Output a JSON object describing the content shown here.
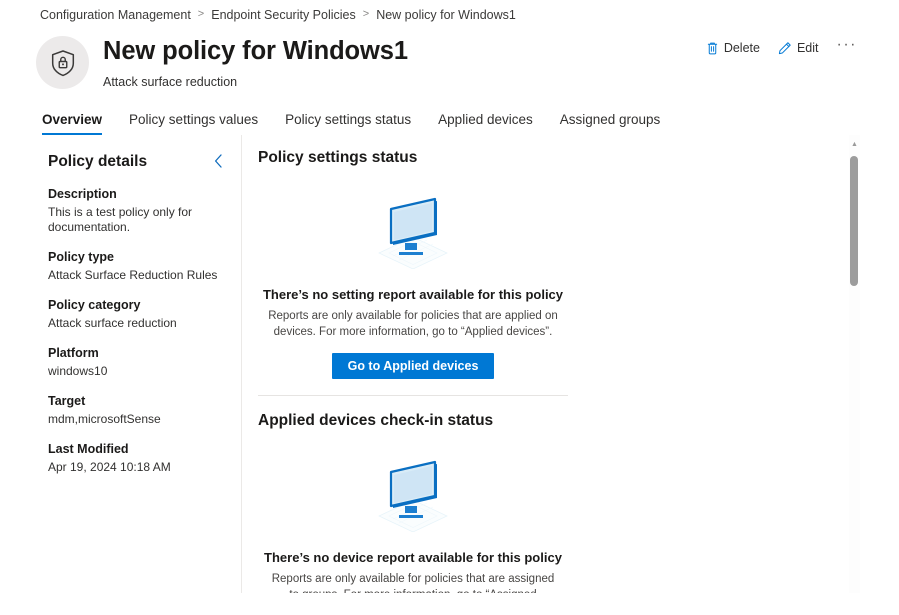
{
  "breadcrumb": {
    "separator": ">",
    "items": [
      {
        "label": "Configuration Management"
      },
      {
        "label": "Endpoint Security Policies"
      },
      {
        "label": "New policy for Windows1"
      }
    ]
  },
  "header": {
    "icon": "shield-lock-icon",
    "title": "New policy for Windows1",
    "subtitle": "Attack surface reduction",
    "actions": {
      "delete_label": "Delete",
      "edit_label": "Edit",
      "more_label": "···"
    }
  },
  "tabs": [
    {
      "label": "Overview",
      "active": true
    },
    {
      "label": "Policy settings values",
      "active": false
    },
    {
      "label": "Policy settings status",
      "active": false
    },
    {
      "label": "Applied devices",
      "active": false
    },
    {
      "label": "Assigned groups",
      "active": false
    }
  ],
  "details_panel": {
    "title": "Policy details",
    "collapse_icon": "chevron-left-icon",
    "fields": [
      {
        "label": "Description",
        "value": "This is a test policy only for documentation."
      },
      {
        "label": "Policy type",
        "value": "Attack Surface Reduction Rules"
      },
      {
        "label": "Policy category",
        "value": "Attack surface reduction"
      },
      {
        "label": "Platform",
        "value": "windows10"
      },
      {
        "label": "Target",
        "value": "mdm,microsoftSense"
      },
      {
        "label": "Last Modified",
        "value": "Apr 19, 2024 10:18 AM"
      }
    ]
  },
  "main": {
    "sections": [
      {
        "title": "Policy settings status",
        "empty_state": {
          "illustration": "monitor-illustration",
          "heading": "There’s no setting report available for this policy",
          "description": "Reports are only available for policies that are applied on devices. For more information, go to “Applied devices”.",
          "button_label": "Go to Applied devices"
        }
      },
      {
        "title": "Applied devices check-in status",
        "empty_state": {
          "illustration": "monitor-illustration",
          "heading": "There’s no device report available for this policy",
          "description": "Reports are only available for policies that are assigned to groups. For more information, go to “Assigned groups”."
        }
      }
    ]
  },
  "scrollbar": {
    "up_arrow": "▲"
  },
  "colors": {
    "accent": "#0078d4",
    "text_primary": "#1b1a19",
    "text_secondary": "#484644",
    "divider": "#e6e4e2"
  }
}
